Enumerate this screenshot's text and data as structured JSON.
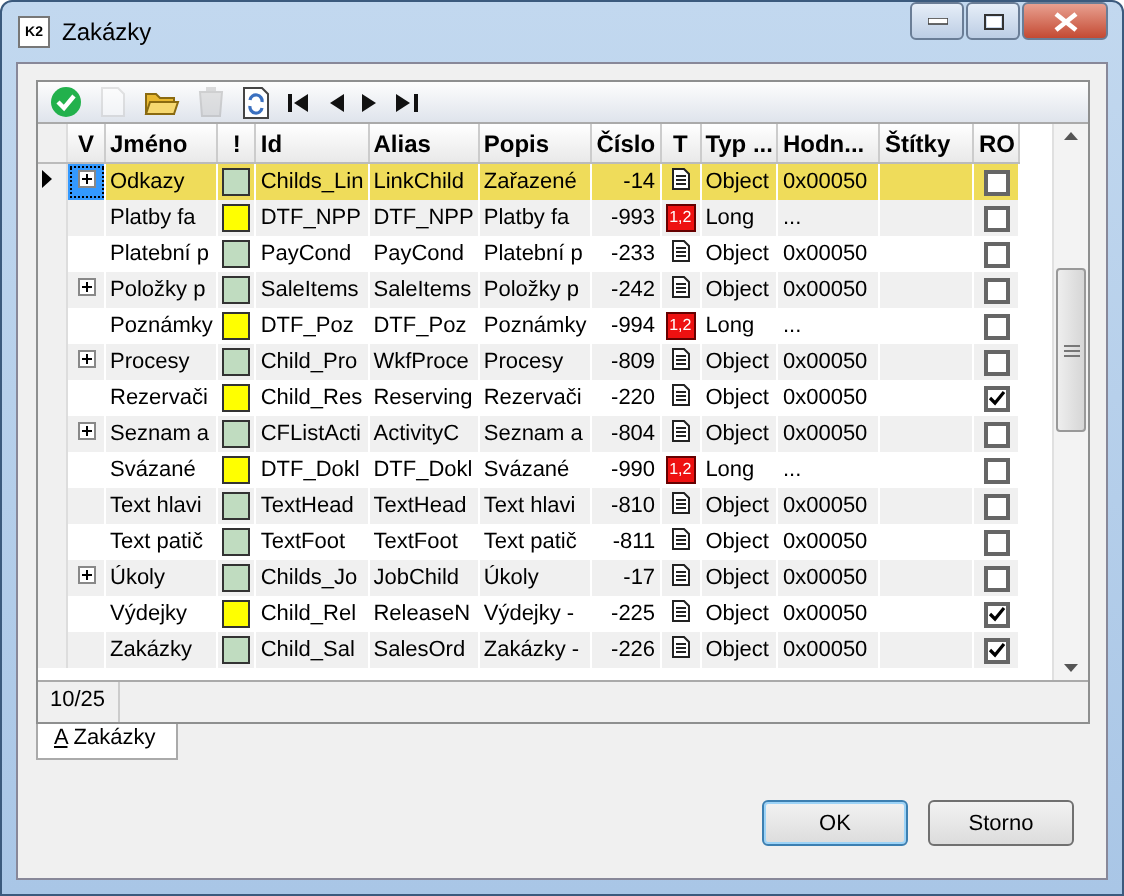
{
  "window": {
    "title": "Zakázky",
    "icon_label": "K2"
  },
  "toolbar": [
    {
      "kind": "confirm",
      "disabled": false
    },
    {
      "kind": "new",
      "disabled": true
    },
    {
      "kind": "open",
      "disabled": false
    },
    {
      "kind": "delete",
      "disabled": true
    },
    {
      "kind": "refresh",
      "disabled": false
    },
    {
      "kind": "first",
      "disabled": false
    },
    {
      "kind": "prev",
      "disabled": false
    },
    {
      "kind": "next",
      "disabled": false
    },
    {
      "kind": "last",
      "disabled": false
    }
  ],
  "table": {
    "columns": [
      "V",
      "Jméno",
      "!",
      "Id",
      "Alias",
      "Popis",
      "Číslo",
      "T",
      "Typ ...",
      "Hodn...",
      "Štítky",
      "RO"
    ],
    "rows": [
      {
        "selected": true,
        "has_children": true,
        "name": "Odkazy",
        "color": "#c0dcc0",
        "id": "Childs_Lin",
        "alias": "LinkChild",
        "popis": "Zařazené",
        "cislo": "-14",
        "kind": "object",
        "typ": "Object",
        "hodn": "0x00050",
        "ro": false
      },
      {
        "selected": false,
        "has_children": false,
        "name": "Platby fa",
        "color": "#ffff00",
        "id": "DTF_NPP",
        "alias": "DTF_NPP",
        "popis": "Platby fa",
        "cislo": "-993",
        "kind": "long",
        "t_label": "1,2",
        "typ": "Long",
        "hodn": "...",
        "ro": false
      },
      {
        "selected": false,
        "has_children": false,
        "name": "Platební p",
        "color": "#c0dcc0",
        "id": "PayCond",
        "alias": "PayCond",
        "popis": "Platební p",
        "cislo": "-233",
        "kind": "object",
        "typ": "Object",
        "hodn": "0x00050",
        "ro": false
      },
      {
        "selected": false,
        "has_children": true,
        "name": "Položky p",
        "color": "#c0dcc0",
        "id": "SaleItems",
        "alias": "SaleItems",
        "popis": "Položky p",
        "cislo": "-242",
        "kind": "object",
        "typ": "Object",
        "hodn": "0x00050",
        "ro": false
      },
      {
        "selected": false,
        "has_children": false,
        "name": "Poznámky",
        "color": "#ffff00",
        "id": "DTF_Poz",
        "alias": "DTF_Poz",
        "popis": "Poznámky",
        "cislo": "-994",
        "kind": "long",
        "t_label": "1,2",
        "typ": "Long",
        "hodn": "...",
        "ro": false
      },
      {
        "selected": false,
        "has_children": true,
        "name": "Procesy",
        "color": "#c0dcc0",
        "id": "Child_Pro",
        "alias": "WkfProce",
        "popis": "Procesy",
        "cislo": "-809",
        "kind": "object",
        "typ": "Object",
        "hodn": "0x00050",
        "ro": false
      },
      {
        "selected": false,
        "has_children": false,
        "name": "Rezervači",
        "color": "#ffff00",
        "id": "Child_Res",
        "alias": "Reserving",
        "popis": "Rezervači",
        "cislo": "-220",
        "kind": "object",
        "typ": "Object",
        "hodn": "0x00050",
        "ro": true
      },
      {
        "selected": false,
        "has_children": true,
        "name": "Seznam a",
        "color": "#c0dcc0",
        "id": "CFListActi",
        "alias": "ActivityC",
        "popis": "Seznam a",
        "cislo": "-804",
        "kind": "object",
        "typ": "Object",
        "hodn": "0x00050",
        "ro": false
      },
      {
        "selected": false,
        "has_children": false,
        "name": "Svázané",
        "color": "#ffff00",
        "id": "DTF_Dokl",
        "alias": "DTF_Dokl",
        "popis": "Svázané",
        "cislo": "-990",
        "kind": "long",
        "t_label": "1,2",
        "typ": "Long",
        "hodn": "...",
        "ro": false
      },
      {
        "selected": false,
        "has_children": false,
        "name": "Text hlavi",
        "color": "#c0dcc0",
        "id": "TextHead",
        "alias": "TextHead",
        "popis": "Text hlavi",
        "cislo": "-810",
        "kind": "object",
        "typ": "Object",
        "hodn": "0x00050",
        "ro": false
      },
      {
        "selected": false,
        "has_children": false,
        "name": "Text patič",
        "color": "#c0dcc0",
        "id": "TextFoot",
        "alias": "TextFoot",
        "popis": "Text patič",
        "cislo": "-811",
        "kind": "object",
        "typ": "Object",
        "hodn": "0x00050",
        "ro": false
      },
      {
        "selected": false,
        "has_children": true,
        "name": "Úkoly",
        "color": "#c0dcc0",
        "id": "Childs_Jo",
        "alias": "JobChild",
        "popis": "Úkoly",
        "cislo": "-17",
        "kind": "object",
        "typ": "Object",
        "hodn": "0x00050",
        "ro": false
      },
      {
        "selected": false,
        "has_children": false,
        "name": "Výdejky",
        "color": "#ffff00",
        "id": "Child_Rel",
        "alias": "ReleaseN",
        "popis": "Výdejky -",
        "cislo": "-225",
        "kind": "object",
        "typ": "Object",
        "hodn": "0x00050",
        "ro": true
      },
      {
        "selected": false,
        "has_children": false,
        "name": "Zakázky",
        "color": "#c0dcc0",
        "id": "Child_Sal",
        "alias": "SalesOrd",
        "popis": "Zakázky -",
        "cislo": "-226",
        "kind": "object",
        "typ": "Object",
        "hodn": "0x00050",
        "ro": true
      }
    ]
  },
  "status_bar": {
    "count": "10/25"
  },
  "tabs": [
    {
      "key": "A",
      "label": "Zakázky",
      "selected": true
    }
  ],
  "buttons": [
    {
      "label": "OK",
      "default": true
    },
    {
      "label": "Storno",
      "default": false
    }
  ]
}
